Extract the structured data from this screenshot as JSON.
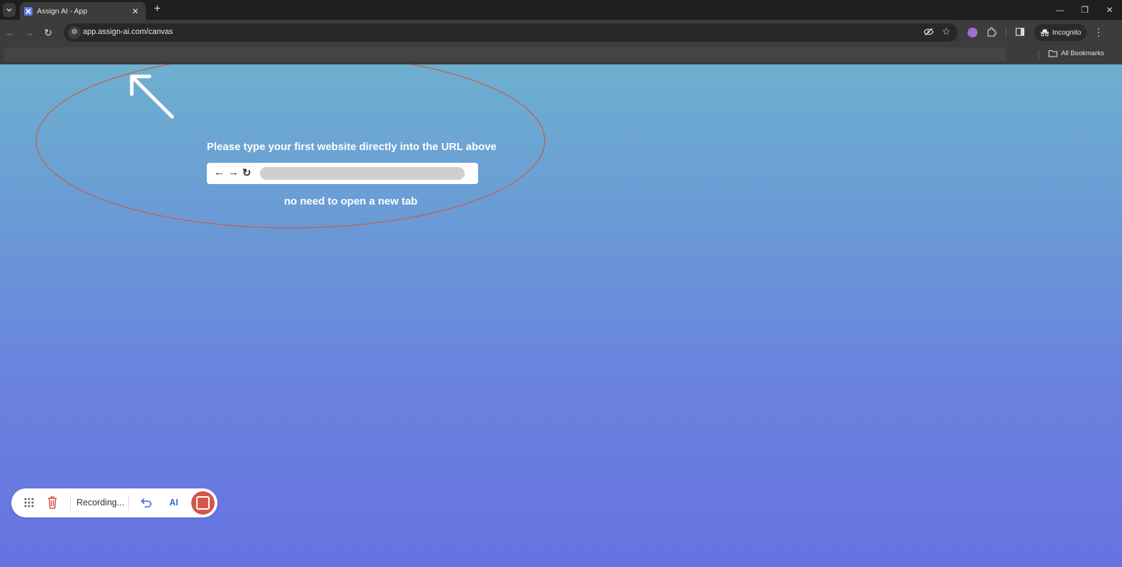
{
  "browser": {
    "tab": {
      "title": "Assign AI - App",
      "favicon": "assign-ai-logo"
    },
    "url": "app.assign-ai.com/canvas",
    "profile_label": "Incognito",
    "bookmarks_label": "All Bookmarks"
  },
  "page": {
    "instruction": "Please type your first website directly into the URL above",
    "subnote": "no need to open a new tab",
    "accent_colors": {
      "ellipse": "#c0614f",
      "gradient_top": "#6db0cf",
      "gradient_bottom": "#6673e1"
    }
  },
  "recorder": {
    "status_label": "Recording...",
    "ai_label": "AI",
    "stop_color": "#d4574a"
  }
}
